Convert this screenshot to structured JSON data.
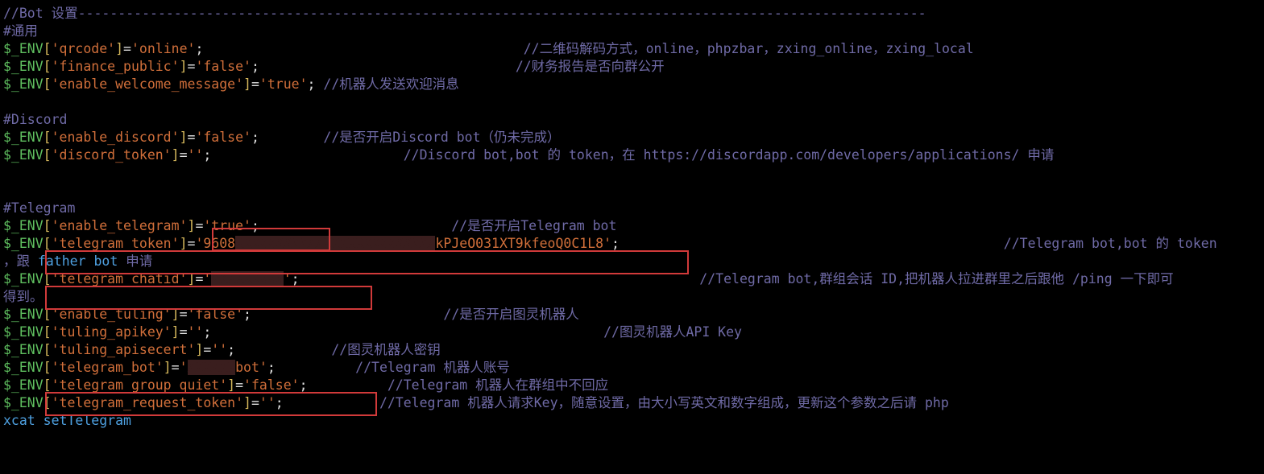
{
  "header": {
    "comment": "//Bot 设置----------------------------------------------------------------------------------------------------------"
  },
  "sections": {
    "common": {
      "header": "#通用",
      "lines": [
        {
          "env": "$_ENV",
          "key": "'qrcode'",
          "value": "'online'",
          "comment": "//二维码解码方式，online，phpzbar，zxing_online，zxing_local"
        },
        {
          "env": "$_ENV",
          "key": "'finance_public'",
          "value": "'false'",
          "comment": "//财务报告是否向群公开"
        },
        {
          "env": "$_ENV",
          "key": "'enable_welcome_message'",
          "value": "'true'",
          "comment": "//机器人发送欢迎消息"
        }
      ]
    },
    "discord": {
      "header": "#Discord",
      "lines": [
        {
          "env": "$_ENV",
          "key": "'enable_discord'",
          "value": "'false'",
          "comment": "//是否开启Discord bot（仍未完成）"
        },
        {
          "env": "$_ENV",
          "key": "'discord_token'",
          "value": "''",
          "comment": "//Discord bot,bot 的 token，在 https://discordapp.com/developers/applications/ 申请"
        }
      ]
    },
    "telegram": {
      "header": "#Telegram",
      "lines": [
        {
          "env": "$_ENV",
          "key": "'enable_telegram'",
          "value": "'true'",
          "comment": "//是否开启Telegram bot"
        }
      ],
      "token_line": {
        "env": "$_ENV",
        "key": "'telegram_token'",
        "value_prefix": "'9608",
        "value_censored": "XXXXXXXXXXXXXXXXXXXXXXXXX",
        "value_suffix": "kPJeO031XT9kfeoQ0C1L8'",
        "comment": "//Telegram bot,bot 的 token"
      },
      "token_wrap": {
        "prefix": "，跟 ",
        "link": "father bot",
        "suffix": " 申请"
      },
      "chatid_line": {
        "env": "$_ENV",
        "key": "'telegram_chatid'",
        "value_prefix": "'",
        "value_censored": "XXXXXXXXX",
        "value_suffix": "'",
        "comment": "//Telegram bot,群组会话 ID,把机器人拉进群里之后跟他 /ping 一下即可"
      },
      "chatid_wrap": "得到。",
      "after": [
        {
          "env": "$_ENV",
          "key": "'enable_tuling'",
          "value": "'false'",
          "comment": "//是否开启图灵机器人"
        },
        {
          "env": "$_ENV",
          "key": "'tuling_apikey'",
          "value": "''",
          "comment": "//图灵机器人API Key"
        },
        {
          "env": "$_ENV",
          "key": "'tuling_apisecert'",
          "value": "''",
          "comment": "//图灵机器人密钥"
        }
      ],
      "bot_line": {
        "env": "$_ENV",
        "key": "'telegram_bot'",
        "value_prefix": "'",
        "value_censored": "XXXXXX",
        "value_suffix": "bot'",
        "comment": "//Telegram 机器人账号"
      },
      "tail": [
        {
          "env": "$_ENV",
          "key": "'telegram_group_quiet'",
          "value": "'false'",
          "comment": "//Telegram 机器人在群组中不回应"
        },
        {
          "env": "$_ENV",
          "key": "'telegram_request_token'",
          "value": "''",
          "comment": "//Telegram 机器人请求Key，随意设置，由大小写英文和数字组成，更新这个参数之后请 php"
        }
      ],
      "tail_wrap": "xcat setTelegram"
    }
  },
  "pads": {
    "p0": "                                        ",
    "p1": "                                ",
    "p2": " ",
    "p3": "        ",
    "p4": "                        ",
    "p5": "                                                                           ",
    "p6": "                        ",
    "p7": "                                                ",
    "p8": "              ",
    "p9": "                                                  ",
    "p10": "                        ",
    "p11": "                                                 ",
    "p12": "            ",
    "p13": "          ",
    "p14": "          ",
    "p15": "            "
  }
}
